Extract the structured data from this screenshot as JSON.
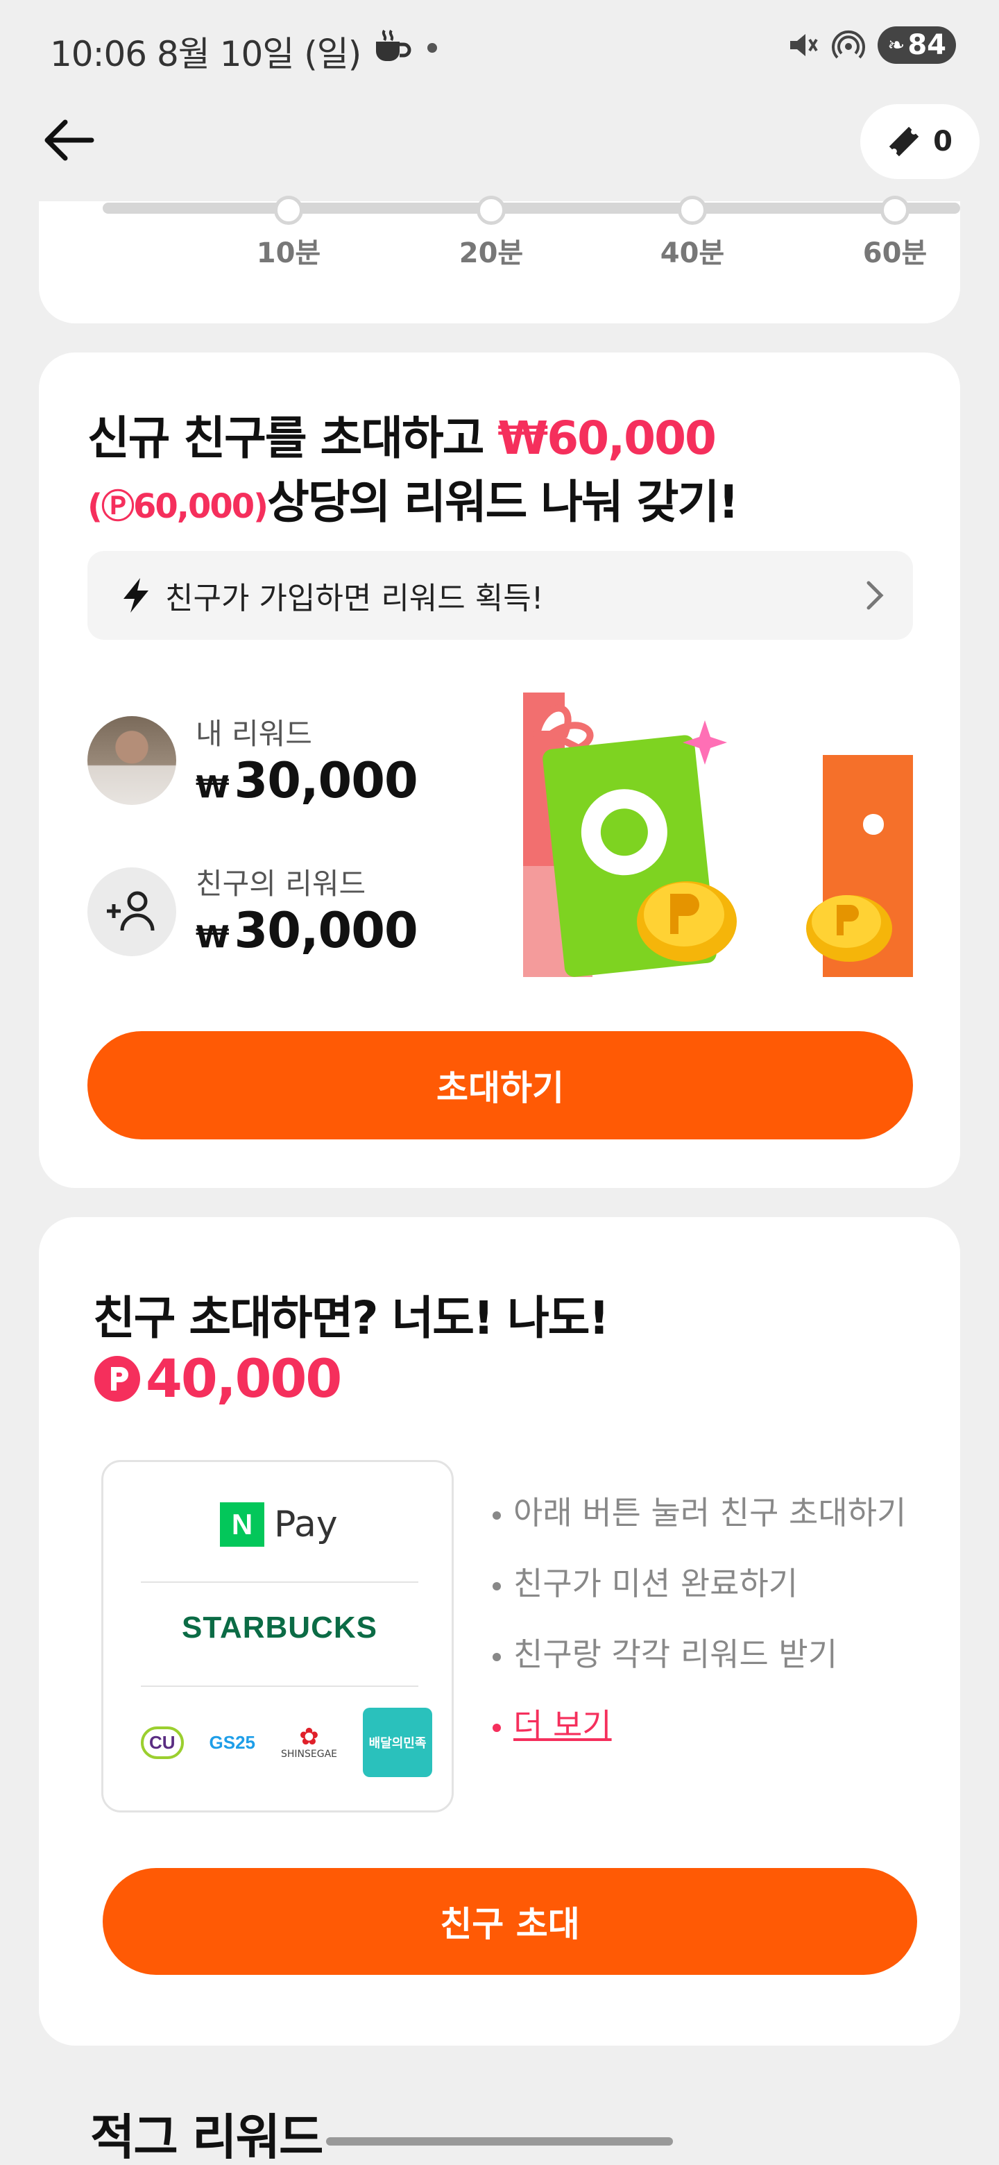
{
  "status_bar": {
    "time_date": "10:06  8월 10일 (일)",
    "battery": "84"
  },
  "header": {
    "ticket_count": "0"
  },
  "slider": {
    "ticks": [
      "10분",
      "20분",
      "40분",
      "60분"
    ]
  },
  "invite_card": {
    "title_prefix": "신규 친구를 초대하고 ",
    "title_amount": "₩60,000",
    "title_points": "(Ⓟ60,000)",
    "title_suffix": "상당의 리워드 나눠 갖기!",
    "info_text": "친구가 가입하면 리워드 획득!",
    "my_reward_label": "내 리워드",
    "my_reward_value": "30,000",
    "friend_reward_label": "친구의 리워드",
    "friend_reward_value": "30,000",
    "won_symbol": "₩",
    "button_label": "초대하기"
  },
  "both_card": {
    "title": "친구 초대하면? 너도! 나도!",
    "amount": "40,000",
    "brands": {
      "npay_n": "N",
      "npay": "Pay",
      "starbucks": "STARBUCKS",
      "cu": "CU",
      "gs25": "GS25",
      "shinsegae": "SHINSEGAE",
      "baemin": "배달의민족"
    },
    "steps": [
      "아래 버튼 눌러 친구 초대하기",
      "친구가 미션 완료하기",
      "친구랑 각각 리워드 받기"
    ],
    "more_link": "더 보기",
    "button_label": "친구 초대"
  },
  "next_section": {
    "title": "적그 리워드"
  },
  "colors": {
    "accent_orange": "#ff5a05",
    "accent_pink": "#f52f5c"
  }
}
